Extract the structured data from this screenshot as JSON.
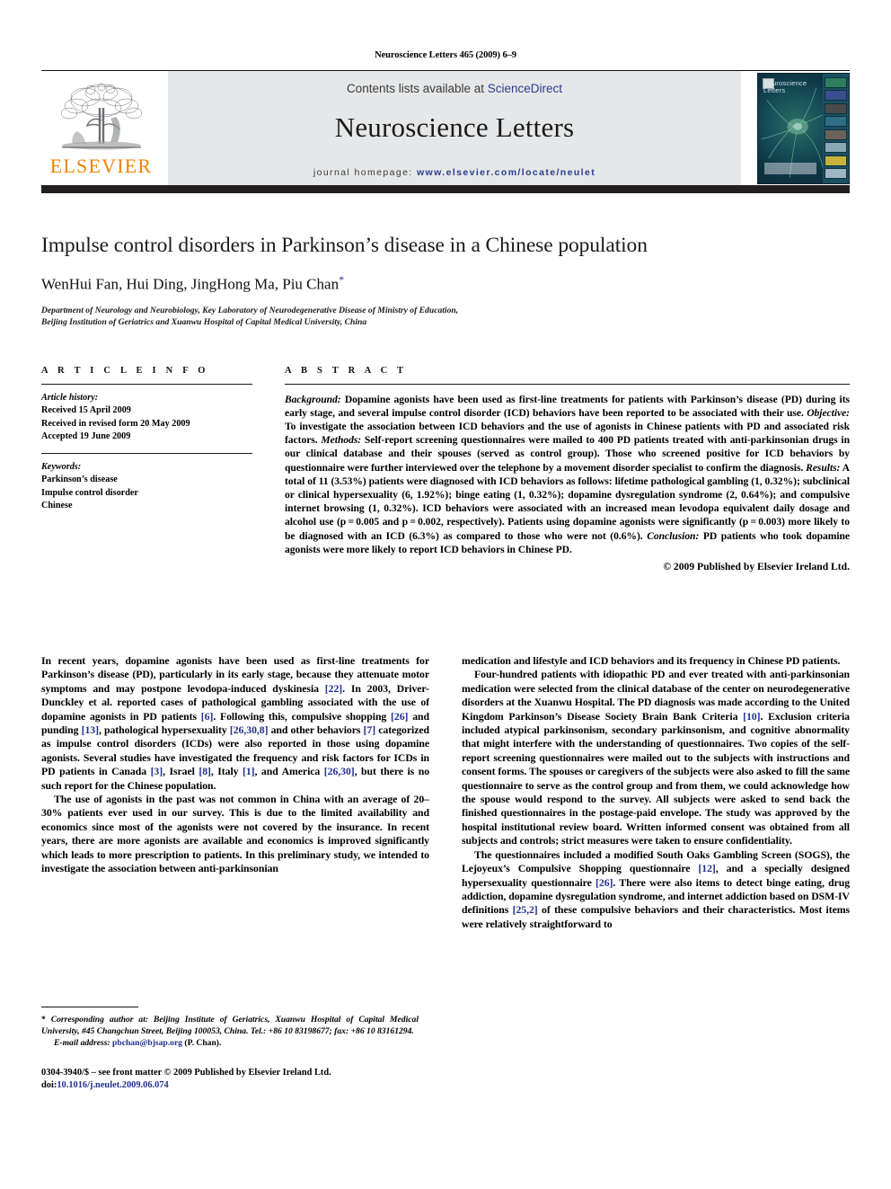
{
  "running_head": "Neuroscience Letters 465 (2009) 6–9",
  "masthead": {
    "publisher_name": "ELSEVIER",
    "contents_prefix": "Contents lists available at ",
    "contents_link": "ScienceDirect",
    "journal_title": "Neuroscience Letters",
    "homepage_prefix": "journal homepage:",
    "homepage_url": "www.elsevier.com/locate/neulet",
    "cover_title_line1": "Neuroscience",
    "cover_title_line2": "Letters"
  },
  "title_block": {
    "title": "Impulse control disorders in Parkinson’s disease in a Chinese population",
    "authors": "WenHui Fan, Hui Ding, JingHong Ma, Piu Chan",
    "corresponding_marker": "*",
    "affiliation_line1": "Department of Neurology and Neurobiology, Key Laboratory of Neurodegenerative Disease of Ministry of Education,",
    "affiliation_line2": "Beijing Institution of Geriatrics and Xuanwu Hospital of Capital Medical University, China"
  },
  "article_info": {
    "heading": "A R T I C L E   I N F O",
    "history_label": "Article history:",
    "history": [
      "Received 15 April 2009",
      "Received in revised form 20 May 2009",
      "Accepted 19 June 2009"
    ],
    "keywords_label": "Keywords:",
    "keywords": [
      "Parkinson’s disease",
      "Impulse control disorder",
      "Chinese"
    ]
  },
  "abstract": {
    "heading": "A B S T R A C T",
    "background_label": "Background:",
    "background_text": " Dopamine agonists have been used as first-line treatments for patients with Parkinson’s disease (PD) during its early stage, and several impulse control disorder (ICD) behaviors have been reported to be associated with their use. ",
    "objective_label": "Objective:",
    "objective_text": " To investigate the association between ICD behaviors and the use of agonists in Chinese patients with PD and associated risk factors. ",
    "methods_label": "Methods:",
    "methods_text": " Self-report screening questionnaires were mailed to 400 PD patients treated with anti-parkinsonian drugs in our clinical database and their spouses (served as control group). Those who screened positive for ICD behaviors by questionnaire were further interviewed over the telephone by a movement disorder specialist to confirm the diagnosis. ",
    "results_label": "Results:",
    "results_text": " A total of 11 (3.53%) patients were diagnosed with ICD behaviors as follows: lifetime pathological gambling (1, 0.32%); subclinical or clinical hypersexuality (6, 1.92%); binge eating (1, 0.32%); dopamine dysregulation syndrome (2, 0.64%); and compulsive internet browsing (1, 0.32%). ICD behaviors were associated with an increased mean levodopa equivalent daily dosage and alcohol use (p = 0.005 and p = 0.002, respectively). Patients using dopamine agonists were significantly (p = 0.003) more likely to be diagnosed with an ICD (6.3%) as compared to those who were not (0.6%). ",
    "conclusion_label": "Conclusion:",
    "conclusion_text": " PD patients who took dopamine agonists were more likely to report ICD behaviors in Chinese PD.",
    "copyright": "© 2009 Published by Elsevier Ireland Ltd."
  },
  "body": {
    "left_col": [
      {
        "segments": [
          {
            "t": "In recent years, dopamine agonists have been used as first-line treatments for Parkinson’s disease (PD), particularly in its early stage, because they attenuate motor symptoms and may postpone levodopa-induced dyskinesia "
          },
          {
            "t": "[22]",
            "ref": true
          },
          {
            "t": ". In 2003, Driver-Dunckley et al. reported cases of pathological gambling associated with the use of dopamine agonists in PD patients "
          },
          {
            "t": "[6]",
            "ref": true
          },
          {
            "t": ". Following this, compulsive shopping "
          },
          {
            "t": "[26]",
            "ref": true
          },
          {
            "t": " and punding "
          },
          {
            "t": "[13]",
            "ref": true
          },
          {
            "t": ", pathological hypersexuality "
          },
          {
            "t": "[26,30,8]",
            "ref": true
          },
          {
            "t": " and other behaviors "
          },
          {
            "t": "[7]",
            "ref": true
          },
          {
            "t": " categorized as impulse control disorders (ICDs) were also reported in those using dopamine agonists. Several studies have investigated the frequency and risk factors for ICDs in PD patients in Canada "
          },
          {
            "t": "[3]",
            "ref": true
          },
          {
            "t": ", Israel "
          },
          {
            "t": "[8]",
            "ref": true
          },
          {
            "t": ", Italy "
          },
          {
            "t": "[1]",
            "ref": true
          },
          {
            "t": ", and America "
          },
          {
            "t": "[26,30]",
            "ref": true
          },
          {
            "t": ", but there is no such report for the Chinese population."
          }
        ]
      },
      {
        "segments": [
          {
            "t": "The use of agonists in the past was not common in China with an average of 20–30% patients ever used in our survey. This is due to the limited availability and economics since most of the agonists were not covered by the insurance. In recent years, there are more agonists are available and economics is improved significantly which leads to more prescription to patients. In this preliminary study, we intended to investigate the association between anti-parkinsonian"
          }
        ]
      }
    ],
    "right_col": [
      {
        "segments": [
          {
            "t": "medication and lifestyle and ICD behaviors and its frequency in Chinese PD patients."
          }
        ]
      },
      {
        "segments": [
          {
            "t": "Four-hundred patients with idiopathic PD and ever treated with anti-parkinsonian medication were selected from the clinical database of the center on neurodegenerative disorders at the Xuanwu Hospital. The PD diagnosis was made according to the United Kingdom Parkinson’s Disease Society Brain Bank Criteria "
          },
          {
            "t": "[10]",
            "ref": true
          },
          {
            "t": ". Exclusion criteria included atypical parkinsonism, secondary parkinsonism, and cognitive abnormality that might interfere with the understanding of questionnaires. Two copies of the self-report screening questionnaires were mailed out to the subjects with instructions and consent forms. The spouses or caregivers of the subjects were also asked to fill the same questionnaire to serve as the control group and from them, we could acknowledge how the spouse would respond to the survey. All subjects were asked to send back the finished questionnaires in the postage-paid envelope. The study was approved by the hospital institutional review board. Written informed consent was obtained from all subjects and controls; strict measures were taken to ensure confidentiality."
          }
        ]
      },
      {
        "segments": [
          {
            "t": "The questionnaires included a modified South Oaks Gambling Screen (SOGS), the Lejoyeux’s Compulsive Shopping questionnaire "
          },
          {
            "t": "[12]",
            "ref": true
          },
          {
            "t": ", and a specially designed hypersexuality questionnaire "
          },
          {
            "t": "[26]",
            "ref": true
          },
          {
            "t": ". There were also items to detect binge eating, drug addiction, dopamine dysregulation syndrome, and internet addiction based on DSM-IV definitions "
          },
          {
            "t": "[25,2]",
            "ref": true
          },
          {
            "t": " of these compulsive behaviors and their characteristics. Most items were relatively straightforward to"
          }
        ]
      }
    ]
  },
  "footnotes": {
    "corresponding_star": "*",
    "corresponding_text": "Corresponding author at: Beijing Institute of Geriatrics, Xuanwu Hospital of Capital Medical University, #45 Changchun Street, Beijing 100053, China. Tel.: +86 10 83198677; fax: +86 10 83161294.",
    "email_label": "E-mail address:",
    "email_address": "pbchan@bjsap.org",
    "email_owner": "(P. Chan).",
    "issn_line": "0304-3940/$ – see front matter © 2009 Published by Elsevier Ireland Ltd.",
    "doi_label": "doi:",
    "doi_value": "10.1016/j.neulet.2009.06.074"
  },
  "colors": {
    "link_blue": "#22308f",
    "elsevier_orange": "#ef8200",
    "masthead_gray": "#e6e7e8",
    "dark_bar": "#231f20"
  }
}
